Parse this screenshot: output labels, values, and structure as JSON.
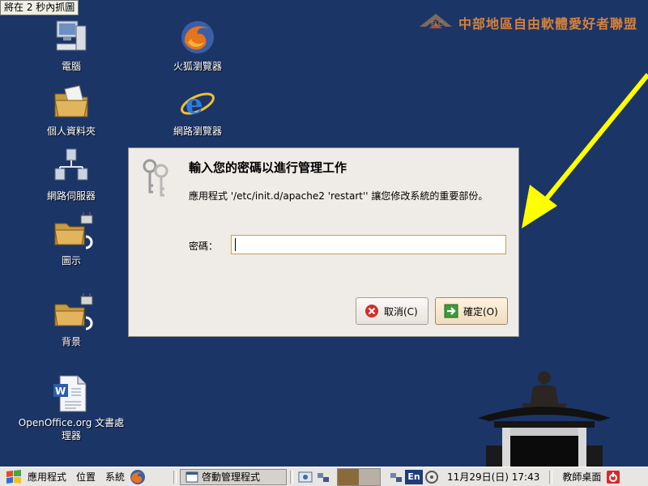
{
  "capture_note": "將在 2 秒內抓圖",
  "brand": {
    "text": "中部地區自由軟體愛好者聯盟"
  },
  "desktop_icons": [
    {
      "label": "電腦",
      "icon": "computer-icon"
    },
    {
      "label": "火狐瀏覽器",
      "icon": "firefox-icon"
    },
    {
      "label": "個人資料夾",
      "icon": "home-folder-icon"
    },
    {
      "label": "網路瀏覽器",
      "icon": "internet-explorer-icon"
    },
    {
      "label": "網路伺服器",
      "icon": "network-server-icon"
    },
    {
      "label": "圖示",
      "icon": "locked-folder-icon"
    },
    {
      "label": "背景",
      "icon": "locked-folder-icon"
    },
    {
      "label": "OpenOffice.org 文書處理器",
      "icon": "writer-document-icon"
    }
  ],
  "dialog": {
    "title": "輸入您的密碼以進行管理工作",
    "message": "應用程式 '/etc/init.d/apache2 'restart'' 讓您修改系統的重要部份。",
    "password_label": "密碼：",
    "password_value": "",
    "cancel_label": "取消(C)",
    "ok_label": "確定(O)"
  },
  "taskbar": {
    "menu_applications": "應用程式",
    "menu_places": "位置",
    "menu_system": "系統",
    "task_label": "啓動管理程式",
    "keyboard_layout": "En",
    "clock": "11月29日(日) 17:43",
    "show_desktop": "教師桌面"
  },
  "colors": {
    "desktop_bg": "#1c3567",
    "arrow": "#ffff00",
    "brand": "#d6813a",
    "dialog_bg": "#efebe6"
  }
}
